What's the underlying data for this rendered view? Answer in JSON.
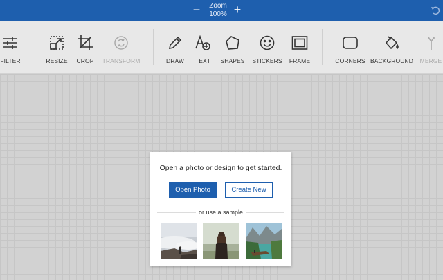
{
  "topbar": {
    "zoom_label": "Zoom",
    "zoom_value": "100%",
    "minus": "−",
    "plus": "+"
  },
  "toolbar": {
    "items": [
      {
        "label": "FILTER",
        "icon": "sliders-icon"
      },
      {
        "label": "RESIZE",
        "icon": "resize-icon"
      },
      {
        "label": "CROP",
        "icon": "crop-icon"
      },
      {
        "label": "TRANSFORM",
        "icon": "transform-icon",
        "disabled": true
      },
      {
        "label": "DRAW",
        "icon": "pencil-icon"
      },
      {
        "label": "TEXT",
        "icon": "text-icon"
      },
      {
        "label": "SHAPES",
        "icon": "shapes-icon"
      },
      {
        "label": "STICKERS",
        "icon": "smiley-icon"
      },
      {
        "label": "FRAME",
        "icon": "frame-icon"
      },
      {
        "label": "CORNERS",
        "icon": "corners-icon"
      },
      {
        "label": "BACKGROUND",
        "icon": "paint-bucket-icon"
      },
      {
        "label": "MERGE",
        "icon": "merge-icon",
        "disabled": true
      }
    ]
  },
  "dialog": {
    "title": "Open a photo or design to get started.",
    "open_photo": "Open Photo",
    "create_new": "Create New",
    "sample_label": "or use a sample"
  },
  "colors": {
    "accent": "#1e5fae",
    "toolbar_bg": "#e8e8e8",
    "canvas_bg": "#d2d2d2"
  }
}
